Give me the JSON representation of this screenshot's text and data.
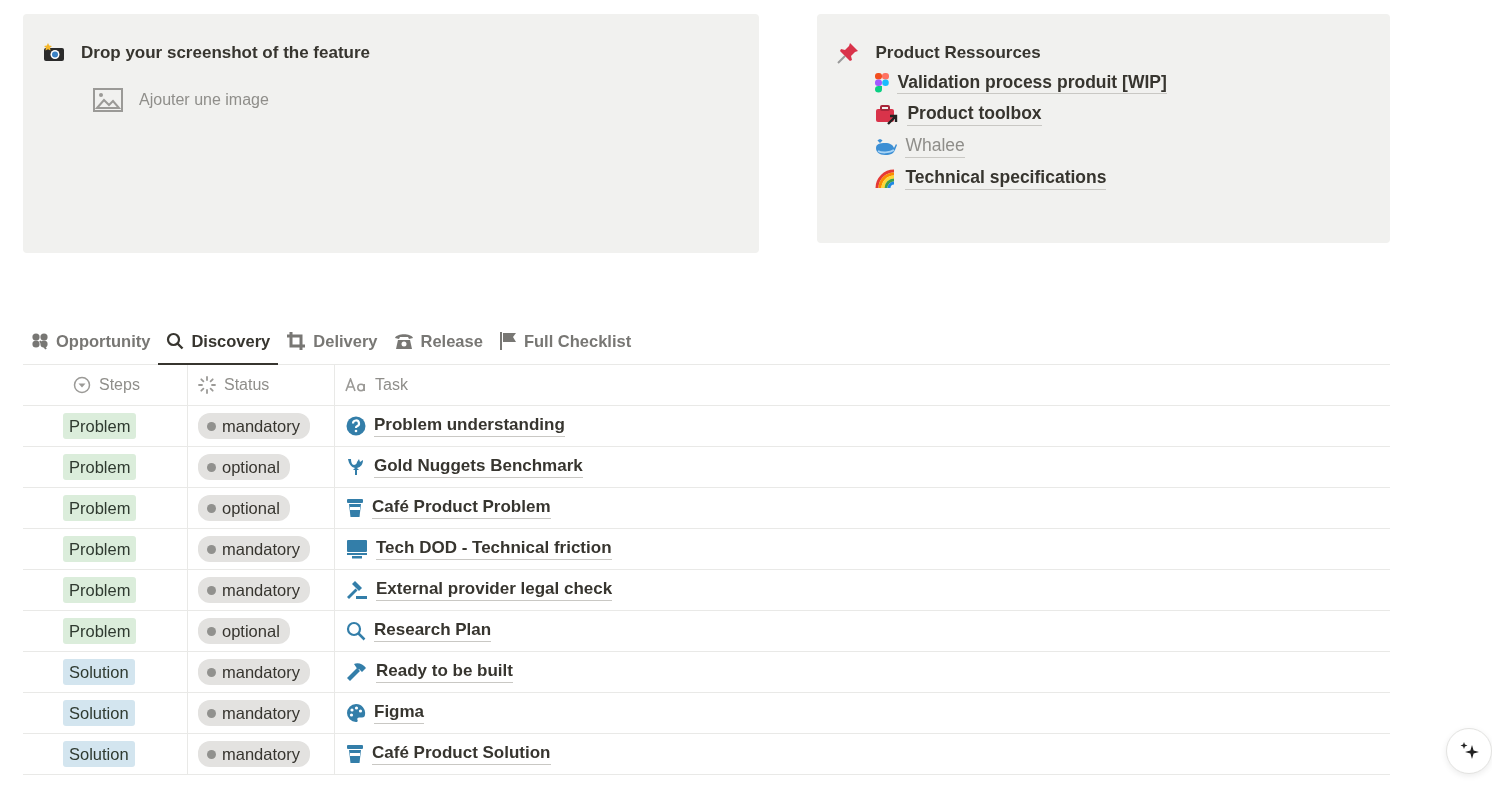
{
  "screenshot_card": {
    "title": "Drop your screenshot of the feature",
    "add_image": "Ajouter une image"
  },
  "resources_card": {
    "title": "Product Ressources",
    "links": [
      {
        "label": "Validation process produit [WIP]",
        "greyed": false
      },
      {
        "label": "Product toolbox",
        "greyed": false
      },
      {
        "label": "Whalee",
        "greyed": true
      },
      {
        "label": "Technical specifications",
        "greyed": false
      }
    ]
  },
  "tabs": [
    {
      "label": "Opportunity",
      "selected": false
    },
    {
      "label": "Discovery",
      "selected": true
    },
    {
      "label": "Delivery",
      "selected": false
    },
    {
      "label": "Release",
      "selected": false
    },
    {
      "label": "Full Checklist",
      "selected": false
    }
  ],
  "table": {
    "columns": [
      "Steps",
      "Status",
      "Task"
    ],
    "rows": [
      {
        "step": "Problem",
        "color": "#dbeddb",
        "status": "mandatory",
        "task": "Problem understanding"
      },
      {
        "step": "Problem",
        "color": "#dbeddb",
        "status": "optional",
        "task": "Gold Nuggets Benchmark"
      },
      {
        "step": "Problem",
        "color": "#dbeddb",
        "status": "optional",
        "task": "Café Product Problem"
      },
      {
        "step": "Problem",
        "color": "#dbeddb",
        "status": "mandatory",
        "task": "Tech DOD - Technical friction"
      },
      {
        "step": "Problem",
        "color": "#dbeddb",
        "status": "mandatory",
        "task": "External provider legal check"
      },
      {
        "step": "Problem",
        "color": "#dbeddb",
        "status": "optional",
        "task": "Research Plan"
      },
      {
        "step": "Solution",
        "color": "#d3e5ef",
        "status": "mandatory",
        "task": "Ready to be built"
      },
      {
        "step": "Solution",
        "color": "#d3e5ef",
        "status": "mandatory",
        "task": "Figma"
      },
      {
        "step": "Solution",
        "color": "#d3e5ef",
        "status": "mandatory",
        "task": "Café Product Solution"
      }
    ]
  }
}
